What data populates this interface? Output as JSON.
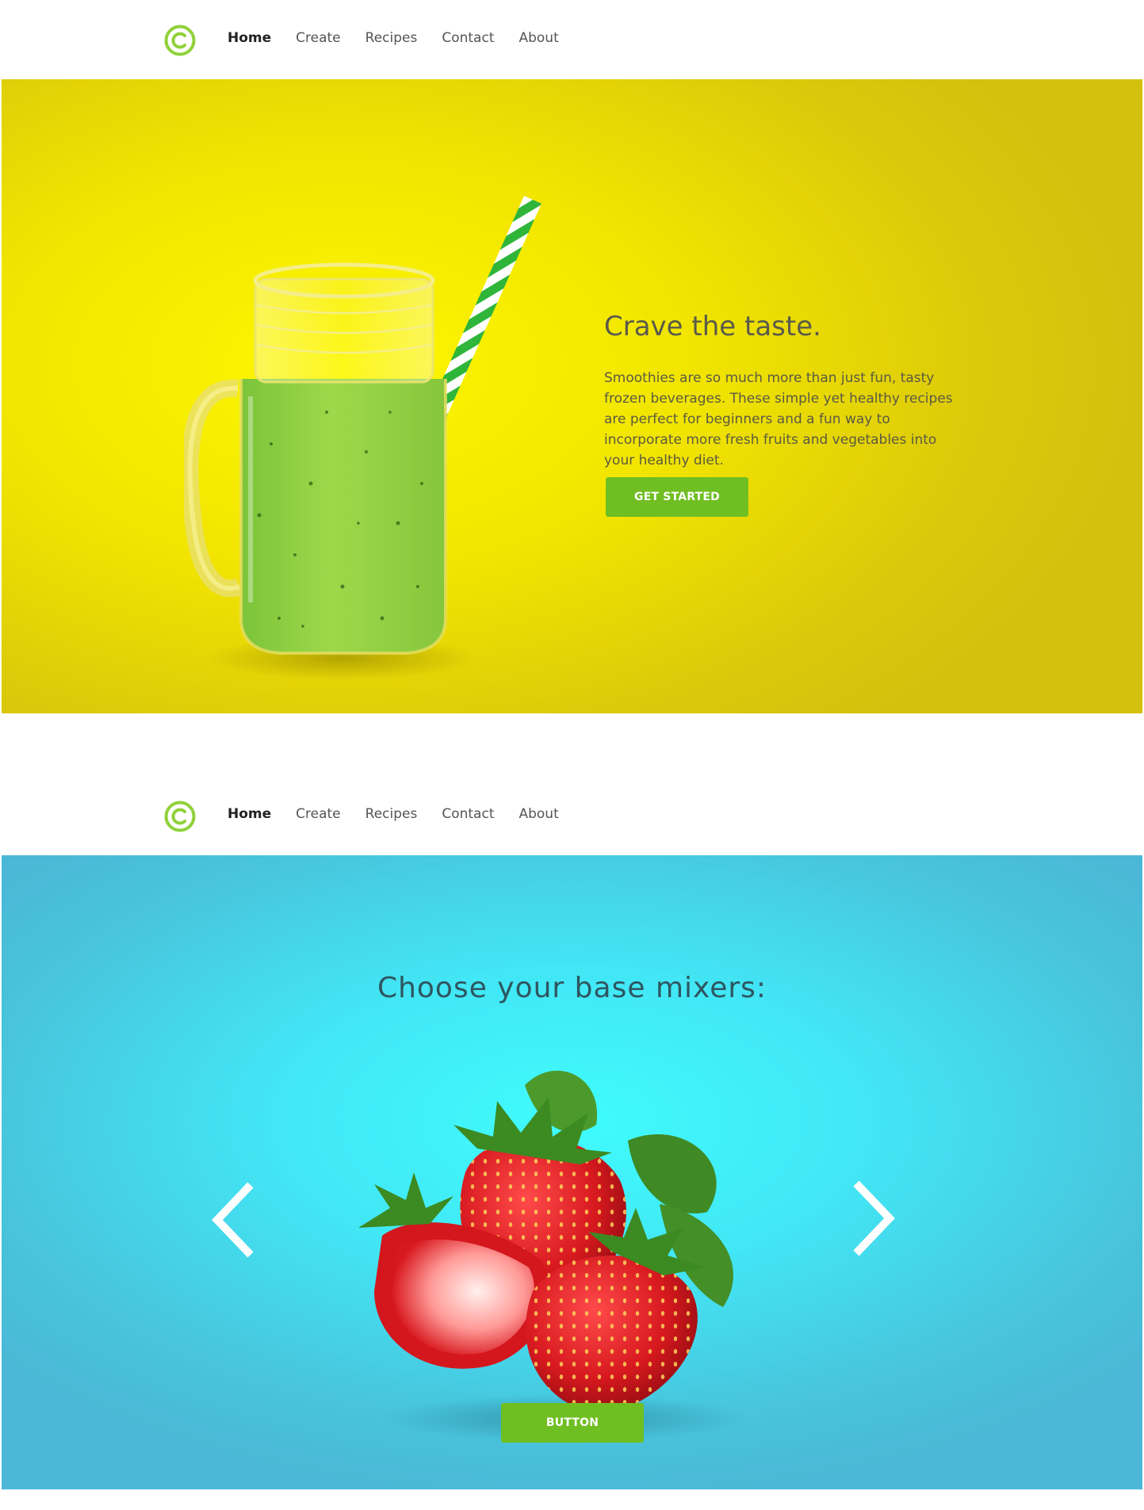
{
  "nav": {
    "items": [
      "Home",
      "Create",
      "Recipes",
      "Contact",
      "About"
    ],
    "active": "Home"
  },
  "hero": {
    "title": "Crave the taste.",
    "text": "Smoothies are so much more than just fun, tasty frozen beverages. These simple yet healthy recipes are perfect for beginners and a fun way to incorporate more fresh fruits and vegetables into your healthy diet.",
    "cta": "GET STARTED"
  },
  "mixers": {
    "title": "Choose your base mixers:",
    "button": "BUTTON"
  },
  "colors": {
    "accent": "#6fbe22",
    "logo": "#8fd13a",
    "hero_yellow": "#f7ef00",
    "mixers_blue": "#42e6f5"
  },
  "icons": [
    "logo-ring-icon",
    "chevron-left-icon",
    "chevron-right-icon"
  ]
}
